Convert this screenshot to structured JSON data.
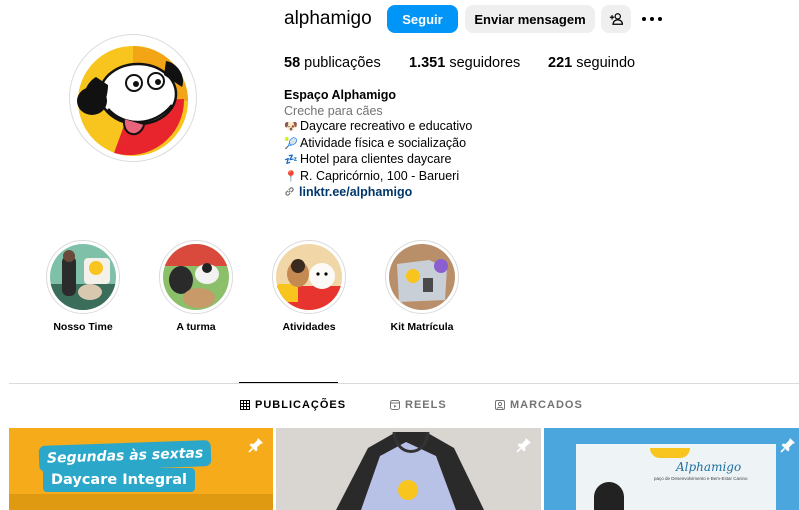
{
  "profile": {
    "username": "alphamigo",
    "follow_label": "Seguir",
    "message_label": "Enviar mensagem",
    "stats": {
      "posts_count": "58",
      "posts_label": "publicações",
      "followers_count": "1.351",
      "followers_label": "seguidores",
      "following_count": "221",
      "following_label": "seguindo"
    },
    "bio": {
      "name": "Espaço Alphamigo",
      "category": "Creche para cães",
      "lines": [
        {
          "emoji": "🐶",
          "text": "Daycare recreativo e educativo"
        },
        {
          "emoji": "🎾",
          "text": "Atividade física e socialização"
        },
        {
          "emoji": "💤",
          "text": "Hotel para clientes daycare"
        },
        {
          "emoji": "📍",
          "text": "R. Capricórnio, 100 - Barueri"
        }
      ],
      "link": "linktr.ee/alphamigo"
    }
  },
  "highlights": [
    {
      "label": "Nosso Time"
    },
    {
      "label": "A turma"
    },
    {
      "label": "Atividades"
    },
    {
      "label": "Kit Matrícula"
    }
  ],
  "tabs": [
    {
      "label": "PUBLICAÇÕES",
      "active": true
    },
    {
      "label": "REELS",
      "active": false
    },
    {
      "label": "MARCADOS",
      "active": false
    }
  ],
  "posts": [
    {
      "line1": "Segundas às sextas",
      "line2": "Daycare Integral"
    },
    {},
    {
      "brand": "Alphamigo",
      "subtitle": "paço de Desenvolvimento e Bem-Estar Canino"
    }
  ],
  "colors": {
    "primary": "#0095f6",
    "secondary_bg": "#efefef",
    "link": "#00376b",
    "muted": "#737373"
  }
}
